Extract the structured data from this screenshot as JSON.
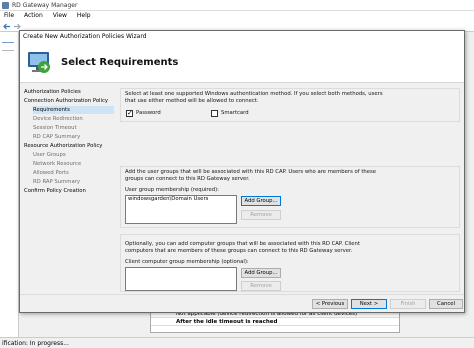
{
  "app": {
    "title": "RD Gateway Manager",
    "menu": [
      "File",
      "Action",
      "View",
      "Help"
    ],
    "bottom_rows": [
      "Not applicable (device redirection is allowed for all client devices)",
      "After the idle timeout is reached"
    ],
    "status": "ification: In progress..."
  },
  "wizard": {
    "title": "Create New Authorization Policies Wizard",
    "header": "Select Requirements",
    "nav": [
      {
        "label": "Authorization Policies",
        "sub": false,
        "active": false
      },
      {
        "label": "Connection Authorization Policy",
        "sub": false,
        "active": false
      },
      {
        "label": "Requirements",
        "sub": true,
        "active": true
      },
      {
        "label": "Device Redirection",
        "sub": true,
        "active": false
      },
      {
        "label": "Session Timeout",
        "sub": true,
        "active": false
      },
      {
        "label": "RD CAP Summary",
        "sub": true,
        "active": false
      },
      {
        "label": "Resource Authorization Policy",
        "sub": false,
        "active": false
      },
      {
        "label": "User Groups",
        "sub": true,
        "active": false
      },
      {
        "label": "Network Resource",
        "sub": true,
        "active": false
      },
      {
        "label": "Allowed Ports",
        "sub": true,
        "active": false
      },
      {
        "label": "RD RAP Summary",
        "sub": true,
        "active": false
      },
      {
        "label": "Confirm Policy Creation",
        "sub": false,
        "active": false
      }
    ],
    "auth": {
      "text_line1": "Select at least one supported Windows authentication method. If you select both methods, users",
      "text_line2": "that use either method will be allowed to connect.",
      "password_label": "Password",
      "password_checked": true,
      "smartcard_label": "Smartcard",
      "smartcard_checked": false
    },
    "user_groups": {
      "text_line1": "Add the user groups that will be associated with this RD CAP. Users who are members of these",
      "text_line2": "groups can connect to this RD Gateway server.",
      "label": "User group membership (required):",
      "items": [
        "windowsgarden\\Domain Users"
      ],
      "add_label": "Add Group...",
      "remove_label": "Remove"
    },
    "computer_groups": {
      "text_line1": "Optionally, you can add computer groups that will be associated with this RD CAP. Client",
      "text_line2": "computers that are members of these groups can connect to this RD Gateway server.",
      "label": "Client computer group membership (optional):",
      "add_label": "Add Group...",
      "remove_label": "Remove"
    },
    "footer": {
      "previous": "< Previous",
      "next": "Next >",
      "finish": "Finish",
      "cancel": "Cancel"
    }
  }
}
